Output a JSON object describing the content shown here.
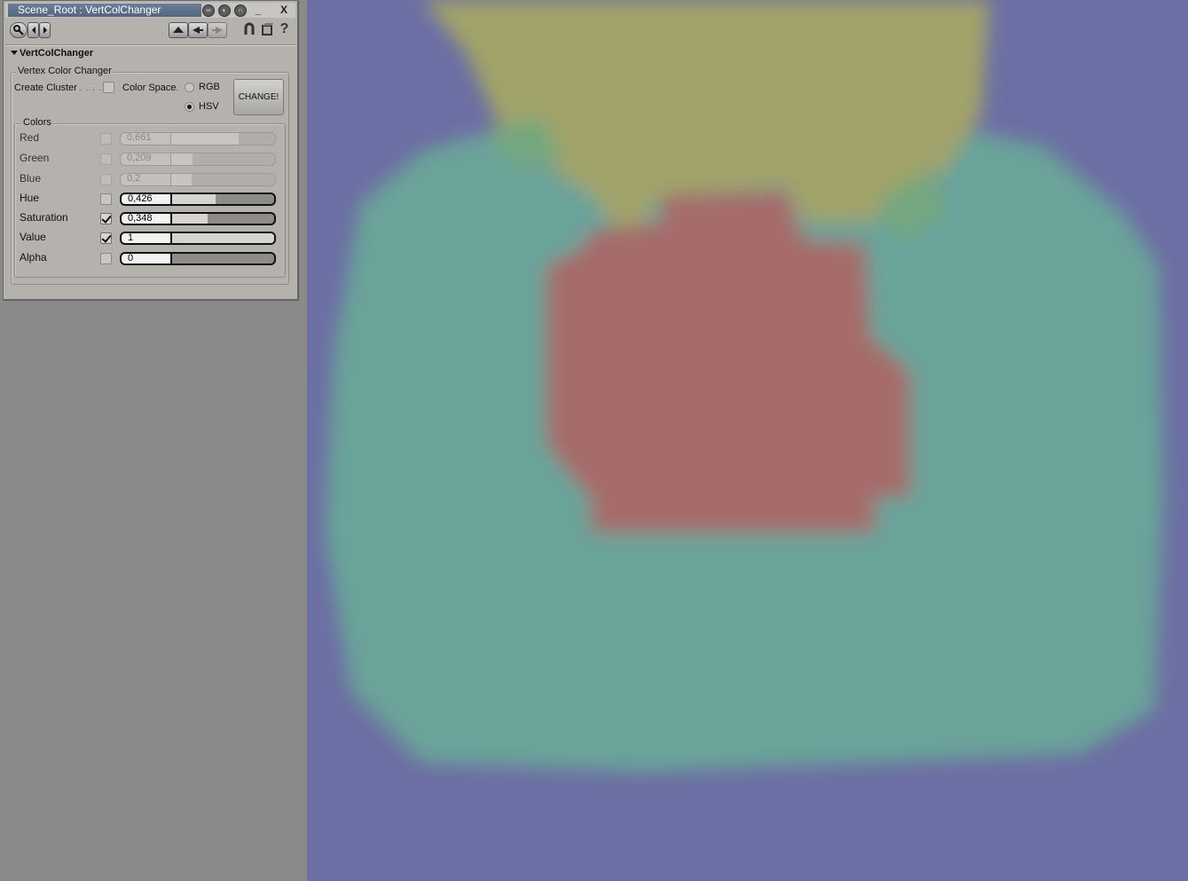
{
  "window": {
    "title": "Scene_Root : VertColChanger",
    "minimize_label": "_",
    "close_label": "X"
  },
  "toolbar": {
    "icons": [
      "key-icon",
      "arrow-left-icon",
      "arrow-right-icon",
      "up-triangle-icon",
      "left-triangle-icon",
      "right-triangle-icon",
      "lock-icon",
      "cube-icon",
      "help-icon"
    ],
    "help_label": "?"
  },
  "section": {
    "title": "VertColChanger"
  },
  "vertex_color_changer": {
    "group_label": "Vertex Color Changer",
    "create_cluster_label": "Create Cluster",
    "create_cluster_dots": ". . . .",
    "create_cluster_checked": false,
    "color_space_label": "Color Space",
    "color_space_dots": ".",
    "color_space_options": [
      "RGB",
      "HSV"
    ],
    "color_space_selected": "HSV",
    "change_button": "CHANGE!"
  },
  "colors": {
    "group_label": "Colors",
    "rows": [
      {
        "label": "Red",
        "value": "0,661",
        "fraction": 0.661,
        "checked": false,
        "enabled": false
      },
      {
        "label": "Green",
        "value": "0,209",
        "fraction": 0.209,
        "checked": false,
        "enabled": false
      },
      {
        "label": "Blue",
        "value": "0,2",
        "fraction": 0.2,
        "checked": false,
        "enabled": false
      },
      {
        "label": "Hue",
        "value": "0,426",
        "fraction": 0.426,
        "checked": false,
        "enabled": true
      },
      {
        "label": "Saturation",
        "value": "0,348",
        "fraction": 0.348,
        "checked": true,
        "enabled": true
      },
      {
        "label": "Value",
        "value": "1",
        "fraction": 1.0,
        "checked": true,
        "enabled": true
      },
      {
        "label": "Alpha",
        "value": "0",
        "fraction": 0.0,
        "checked": false,
        "enabled": true
      }
    ]
  },
  "viewport": {
    "background_color": "#6c6fa3",
    "region_colors": {
      "teal": "#6aa39a",
      "olive": "#a1a36b",
      "red": "#a56c6b",
      "green": "#74a77f"
    }
  }
}
